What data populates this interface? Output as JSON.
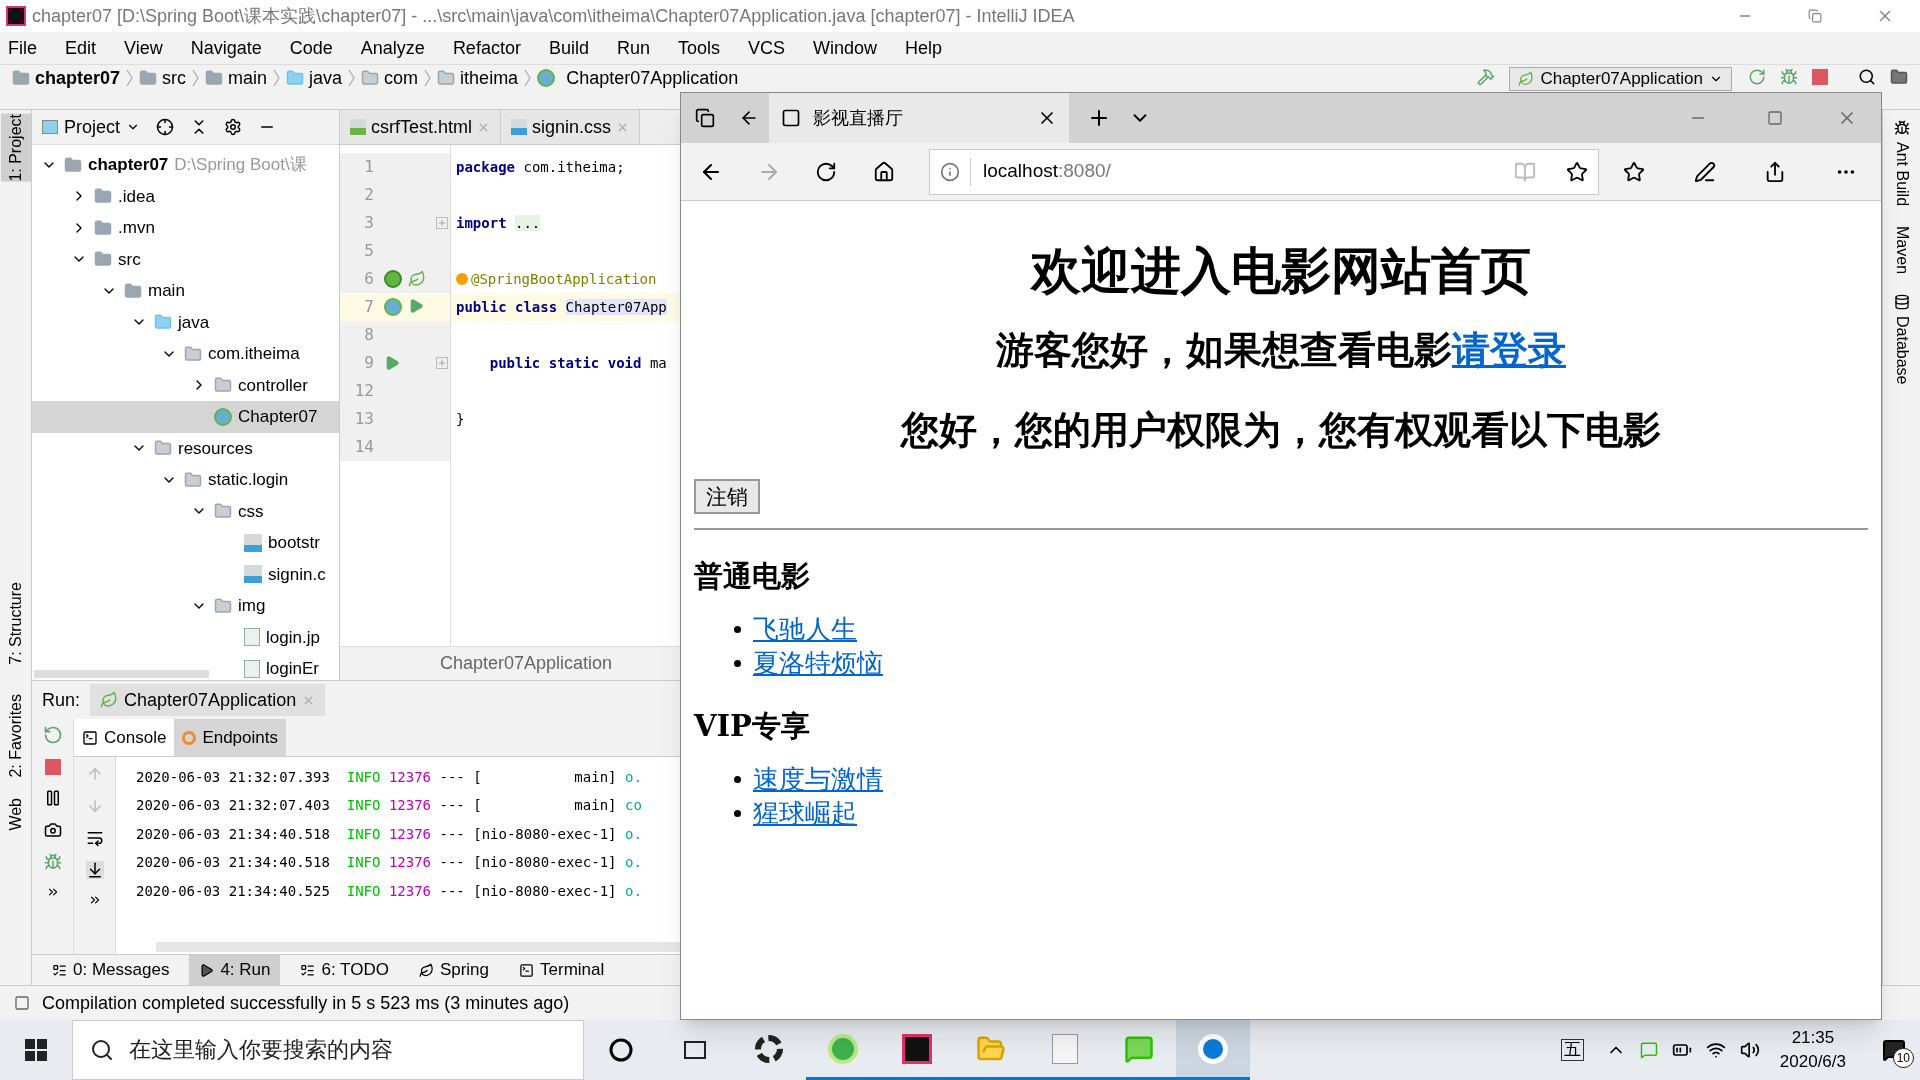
{
  "window": {
    "title": "chapter07 [D:\\Spring Boot\\课本实践\\chapter07] - ...\\src\\main\\java\\com\\itheima\\Chapter07Application.java [chapter07] - IntelliJ IDEA"
  },
  "menu": [
    "File",
    "Edit",
    "View",
    "Navigate",
    "Code",
    "Analyze",
    "Refactor",
    "Build",
    "Run",
    "Tools",
    "VCS",
    "Window",
    "Help"
  ],
  "breadcrumb": [
    {
      "label": "chapter07",
      "kind": "project"
    },
    {
      "label": "src",
      "kind": "folder"
    },
    {
      "label": "main",
      "kind": "folder"
    },
    {
      "label": "java",
      "kind": "source"
    },
    {
      "label": "com",
      "kind": "package"
    },
    {
      "label": "itheima",
      "kind": "package"
    },
    {
      "label": "Chapter07Application",
      "kind": "class"
    }
  ],
  "run_config": "Chapter07Application",
  "left_strip": [
    {
      "label": "1: Project",
      "selected": true
    },
    {
      "label": "7: Structure",
      "selected": false
    },
    {
      "label": "2: Favorites",
      "selected": false
    },
    {
      "label": "Web",
      "selected": false
    }
  ],
  "right_strip": [
    "Ant Build",
    "Maven",
    "Database"
  ],
  "project_panel": {
    "title": "Project",
    "tree": [
      {
        "label": "chapter07",
        "hint": "D:\\Spring Boot\\课",
        "kind": "project",
        "expanded": true,
        "selected": false,
        "children": [
          {
            "label": ".idea",
            "kind": "folder",
            "expanded": false,
            "selected": false
          },
          {
            "label": ".mvn",
            "kind": "folder",
            "expanded": false,
            "selected": false
          },
          {
            "label": "src",
            "kind": "folder",
            "expanded": true,
            "selected": false,
            "children": [
              {
                "label": "main",
                "kind": "folder",
                "expanded": true,
                "selected": false,
                "children": [
                  {
                    "label": "java",
                    "kind": "source",
                    "expanded": true,
                    "selected": false,
                    "children": [
                      {
                        "label": "com.itheima",
                        "kind": "package",
                        "expanded": true,
                        "selected": false,
                        "children": [
                          {
                            "label": "controller",
                            "kind": "package",
                            "expanded": false,
                            "selected": false
                          },
                          {
                            "label": "Chapter07",
                            "kind": "class",
                            "selected": true
                          }
                        ]
                      }
                    ]
                  },
                  {
                    "label": "resources",
                    "kind": "resources",
                    "expanded": true,
                    "selected": false,
                    "children": [
                      {
                        "label": "static.login",
                        "kind": "package",
                        "expanded": true,
                        "selected": false,
                        "children": [
                          {
                            "label": "css",
                            "kind": "package",
                            "expanded": true,
                            "selected": false,
                            "children": [
                              {
                                "label": "bootstr",
                                "kind": "css",
                                "selected": false
                              },
                              {
                                "label": "signin.c",
                                "kind": "css",
                                "selected": false
                              }
                            ]
                          },
                          {
                            "label": "img",
                            "kind": "package",
                            "expanded": true,
                            "selected": false,
                            "children": [
                              {
                                "label": "login.jp",
                                "kind": "image",
                                "selected": false
                              },
                              {
                                "label": "loginEr",
                                "kind": "image",
                                "selected": false
                              }
                            ]
                          }
                        ]
                      }
                    ]
                  }
                ]
              }
            ]
          }
        ]
      }
    ]
  },
  "editor": {
    "tabs": [
      {
        "label": "csrfTest.html",
        "kind": "html",
        "selected": false
      },
      {
        "label": "signin.css",
        "kind": "css",
        "selected": false
      }
    ],
    "lines": [
      {
        "number": "1",
        "current": false,
        "tokens": [
          {
            "kind": "keyword",
            "text": "package"
          },
          {
            "kind": "plain",
            "text": "com.itheima;"
          }
        ]
      },
      {
        "number": "2",
        "current": false
      },
      {
        "number": "3",
        "current": false,
        "gutter": [
          {
            "kind": "fold"
          }
        ],
        "tokens": [
          {
            "kind": "keyword",
            "text": "import"
          },
          {
            "kind": "folded",
            "text": "..."
          }
        ]
      },
      {
        "number": "5",
        "current": false
      },
      {
        "number": "6",
        "current": false,
        "gutter": [
          {
            "kind": "bean"
          },
          {
            "kind": "leaf"
          }
        ],
        "tokens": [
          {
            "kind": "annotation",
            "text": "@SpringBootApplication"
          }
        ]
      },
      {
        "number": "7",
        "current": true,
        "gutter": [
          {
            "kind": "spring-class"
          },
          {
            "kind": "run"
          }
        ],
        "tokens": [
          {
            "kind": "keyword",
            "text": "public class"
          },
          {
            "kind": "highlight",
            "text": "Chapter07App"
          }
        ]
      },
      {
        "number": "8",
        "current": false
      },
      {
        "number": "9",
        "current": false,
        "gutter": [
          {
            "kind": "run"
          },
          {
            "kind": "fold"
          }
        ],
        "tokens": [
          {
            "kind": "keyword",
            "text": "    public static void"
          },
          {
            "kind": "plain",
            "text": "ma"
          }
        ]
      },
      {
        "number": "12",
        "current": false
      },
      {
        "number": "13",
        "current": false,
        "tokens": [
          {
            "kind": "plain",
            "text": "}"
          }
        ]
      },
      {
        "number": "14",
        "current": false
      }
    ],
    "footer": "Chapter07Application"
  },
  "run_panel": {
    "label": "Run:",
    "config_tab": "Chapter07Application",
    "tabs": [
      {
        "label": "Console",
        "kind": "console",
        "selected": true
      },
      {
        "label": "Endpoints",
        "kind": "endpoints",
        "selected": false
      }
    ],
    "log": [
      {
        "time": "2020-06-03 21:32:07.393",
        "level": "INFO",
        "pid": "12376",
        "sep": "---",
        "thread": "[           main]",
        "logger": "o."
      },
      {
        "time": "2020-06-03 21:32:07.403",
        "level": "INFO",
        "pid": "12376",
        "sep": "---",
        "thread": "[           main]",
        "logger": "co"
      },
      {
        "time": "2020-06-03 21:34:40.518",
        "level": "INFO",
        "pid": "12376",
        "sep": "---",
        "thread": "[nio-8080-exec-1]",
        "logger": "o."
      },
      {
        "time": "2020-06-03 21:34:40.518",
        "level": "INFO",
        "pid": "12376",
        "sep": "---",
        "thread": "[nio-8080-exec-1]",
        "logger": "o."
      },
      {
        "time": "2020-06-03 21:34:40.525",
        "level": "INFO",
        "pid": "12376",
        "sep": "---",
        "thread": "[nio-8080-exec-1]",
        "logger": "o."
      }
    ]
  },
  "bottom_tabs": [
    {
      "label": "0: Messages",
      "kind": "messages",
      "selected": false
    },
    {
      "label": "4: Run",
      "kind": "run",
      "selected": true
    },
    {
      "label": "6: TODO",
      "kind": "todo",
      "selected": false
    },
    {
      "label": "Spring",
      "kind": "spring",
      "selected": false
    },
    {
      "label": "Terminal",
      "kind": "terminal",
      "selected": false
    }
  ],
  "status": "Compilation completed successfully in 5 s 523 ms (3 minutes ago)",
  "browser": {
    "tab": "影视直播厅",
    "url_host": "localhost",
    "url_rest": ":8080/",
    "page": {
      "title": "欢迎进入电影网站首页",
      "greeting": "游客您好，如果想查看电影",
      "login_link": "请登录",
      "notice": "您好，您的用户权限为，您有权观看以下电影",
      "logout": "注销",
      "sections": [
        {
          "heading": "普通电影",
          "kind": "cjk",
          "links": [
            "飞驰人生",
            "夏洛特烦恼"
          ]
        },
        {
          "heading": "VIP专享",
          "kind": "vip",
          "links": [
            "速度与激情",
            "猩球崛起"
          ]
        }
      ]
    }
  },
  "taskbar": {
    "search_placeholder": "在这里输入你要搜索的内容",
    "apps": [
      {
        "kind": "pinwheel",
        "running": false,
        "selected": false
      },
      {
        "kind": "ie",
        "running": true,
        "selected": false
      },
      {
        "kind": "intellij",
        "running": true,
        "selected": false
      },
      {
        "kind": "explorer",
        "running": true,
        "selected": false
      },
      {
        "kind": "typora",
        "running": true,
        "selected": false
      },
      {
        "kind": "wechat",
        "running": true,
        "selected": false
      },
      {
        "kind": "edge",
        "running": true,
        "selected": true
      }
    ],
    "ime": "五",
    "time": "21:35",
    "date": "2020/6/3",
    "notifications": "10"
  }
}
